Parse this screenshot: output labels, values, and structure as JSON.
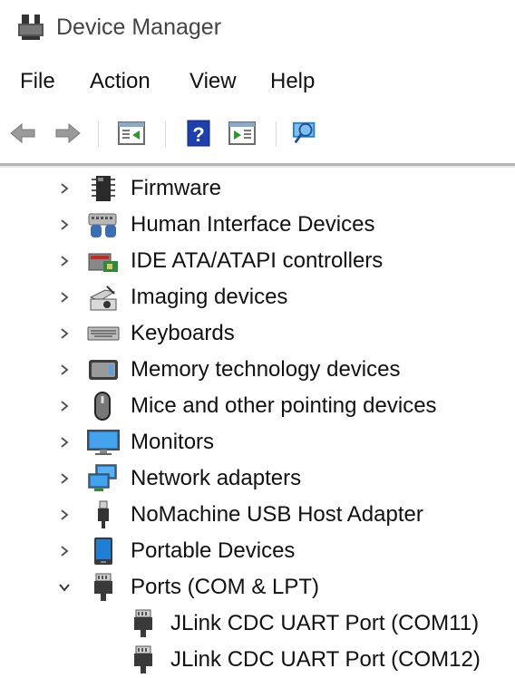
{
  "window": {
    "title": "Device Manager"
  },
  "menu": {
    "file": "File",
    "action": "Action",
    "view": "View",
    "help": "Help"
  },
  "tree": {
    "firmware": "Firmware",
    "hid": "Human Interface Devices",
    "ide": "IDE ATA/ATAPI controllers",
    "imaging": "Imaging devices",
    "keyboards": "Keyboards",
    "memory": "Memory technology devices",
    "mice": "Mice and other pointing devices",
    "monitors": "Monitors",
    "network": "Network adapters",
    "nomachine": "NoMachine USB Host Adapter",
    "portable": "Portable Devices",
    "ports": "Ports (COM & LPT)",
    "com11": "JLink CDC UART Port (COM11)",
    "com12": "JLink CDC UART Port (COM12)"
  },
  "icons": [
    "device-manager-icon",
    "back-arrow-icon",
    "forward-arrow-icon",
    "properties-icon",
    "help-icon",
    "update-driver-icon",
    "scan-hardware-icon",
    "chip-icon",
    "hid-icon",
    "ide-controller-icon",
    "camera-icon",
    "keyboard-icon",
    "memory-card-icon",
    "mouse-icon",
    "monitor-icon",
    "network-icon",
    "usb-plug-icon",
    "portable-device-icon",
    "port-icon"
  ],
  "colors": {
    "accent_blue": "#1e7fd6",
    "chevron": "#555555"
  }
}
